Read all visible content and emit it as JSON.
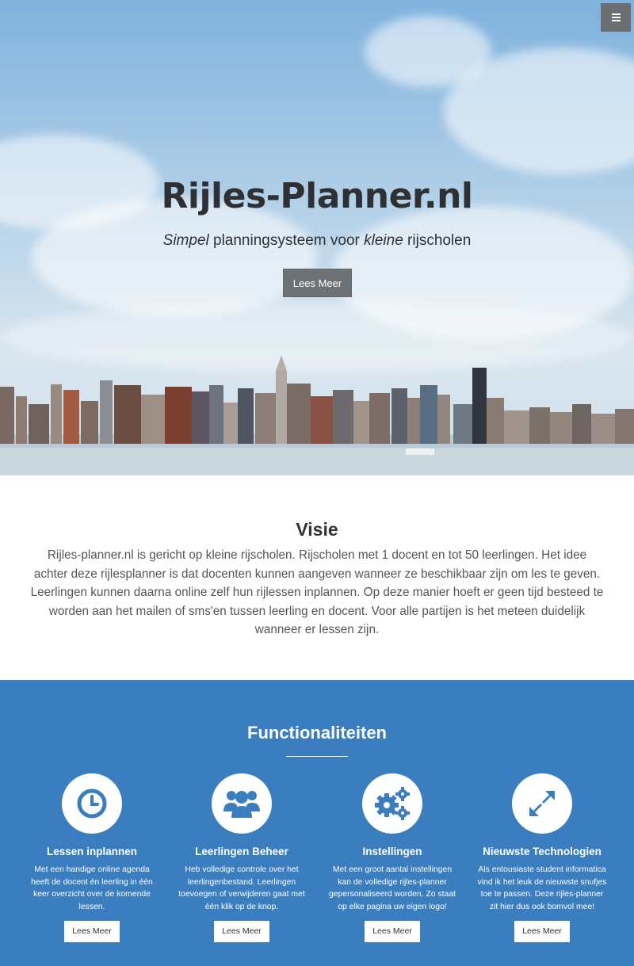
{
  "nav": {
    "menu_icon": "bars-icon"
  },
  "hero": {
    "title": "Rijles-Planner.nl",
    "subtitle_parts": [
      "Simpel",
      " planningsysteem voor ",
      "kleine",
      " rijscholen"
    ],
    "button_label": "Lees Meer"
  },
  "visie": {
    "title": "Visie",
    "text": "Rijles-planner.nl is gericht op kleine rijscholen. Rijscholen met 1 docent en tot 50 leerlingen. Het idee achter deze rijlesplanner is dat docenten kunnen aangeven wanneer ze beschikbaar zijn om les te geven. Leerlingen kunnen daarna online zelf hun rijlessen inplannen. Op deze manier hoeft er geen tijd besteed te worden aan het mailen of sms'en tussen leerling en docent. Voor alle partijen is het meteen duidelijk wanneer er lessen zijn."
  },
  "functionaliteiten": {
    "title": "Functionaliteiten",
    "features": [
      {
        "icon": "clock-icon",
        "title": "Lessen inplannen",
        "text": "Met een handige online agenda heeft de docent én leerling in één keer overzicht over de komende lessen.",
        "button": "Lees Meer"
      },
      {
        "icon": "users-icon",
        "title": "Leerlingen Beheer",
        "text": "Heb volledige controle over het leerlingenbestand. Leerlingen toevoegen of verwijderen gaat met één klik op de knop.",
        "button": "Lees Meer"
      },
      {
        "icon": "gears-icon",
        "title": "Instellingen",
        "text": "Met een groot aantal instellingen kan de volledige rijles-planner gepersonaliseerd worden. Zo staat op elke pagina uw eigen logo!",
        "button": "Lees Meer"
      },
      {
        "icon": "expand-arrows-icon",
        "title": "Nieuwste Technologien",
        "text": "Als entousiaste student informatica vind ik het leuk de nieuwste snufjes toe te passen. Deze rijles-planner zit hier dus ook bomvol mee!",
        "button": "Lees Meer"
      }
    ]
  },
  "colors": {
    "accent_blue": "#3b7ebf",
    "button_gray": "#6d7276",
    "icon_blue": "#3b7ebf"
  }
}
